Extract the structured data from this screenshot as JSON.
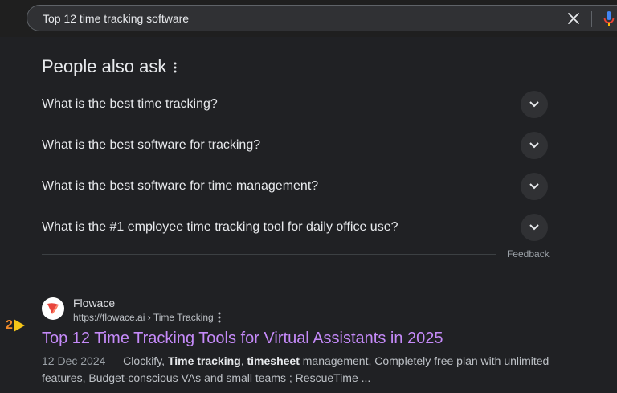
{
  "search": {
    "query": "Top 12 time tracking software"
  },
  "paa": {
    "title": "People also ask",
    "questions": [
      "What is the best time tracking?",
      "What is the best software for tracking?",
      "What is the best software for time management?",
      "What is the #1 employee time tracking tool for daily office use?"
    ],
    "feedback": "Feedback"
  },
  "result": {
    "marker": "2",
    "site_name": "Flowace",
    "url": "https://flowace.ai › Time Tracking",
    "title": "Top 12 Time Tracking Tools for Virtual Assistants in 2025",
    "date": "12 Dec 2024",
    "snippet_parts": [
      " — Clockify, ",
      "Time tracking",
      ", ",
      "timesheet",
      " management, Completely free plan with unlimited features, Budget-conscious VAs and small teams ; RescueTime ..."
    ]
  },
  "colors": {
    "background": "#202124",
    "link_visited": "#c58af9",
    "marker_number": "#f28b2a",
    "marker_arrow": "#f5c518"
  },
  "icons": {
    "clear": "close-icon",
    "mic": "microphone-icon",
    "more": "more-vert-icon",
    "expand": "chevron-down-icon",
    "favicon": "flowace-logo"
  }
}
